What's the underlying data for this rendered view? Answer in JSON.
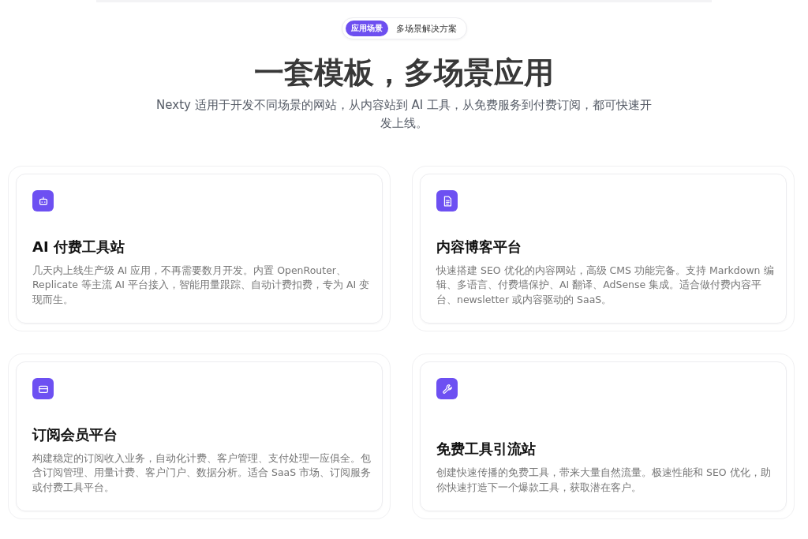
{
  "badge": {
    "tag": "应用场景",
    "text": "多场景解决方案"
  },
  "heading": "一套模板，多场景应用",
  "subtitle": "Nexty 适用于开发不同场景的网站，从内容站到 AI 工具，从免费服务到付费订阅，都可快速开发上线。",
  "cards": [
    {
      "title": "AI 付费工具站",
      "description": "几天内上线生产级 AI 应用，不再需要数月开发。内置 OpenRouter、Replicate 等主流 AI 平台接入，智能用量跟踪、自动计费扣费，专为 AI 变现而生。"
    },
    {
      "title": "内容博客平台",
      "description": "快速搭建 SEO 优化的内容网站，高级 CMS 功能完备。支持 Markdown 编辑、多语言、付费墙保护、AI 翻译、AdSense 集成。适合做付费内容平台、newsletter 或内容驱动的 SaaS。"
    },
    {
      "title": "订阅会员平台",
      "description": "构建稳定的订阅收入业务，自动化计费、客户管理、支付处理一应俱全。包含订阅管理、用量计费、客户门户、数据分析。适合 SaaS 市场、订阅服务或付费工具平台。"
    },
    {
      "title": "免费工具引流站",
      "description": "创建快速传播的免费工具，带来大量自然流量。极速性能和 SEO 优化，助你快速打造下一个爆款工具，获取潜在客户。"
    }
  ]
}
